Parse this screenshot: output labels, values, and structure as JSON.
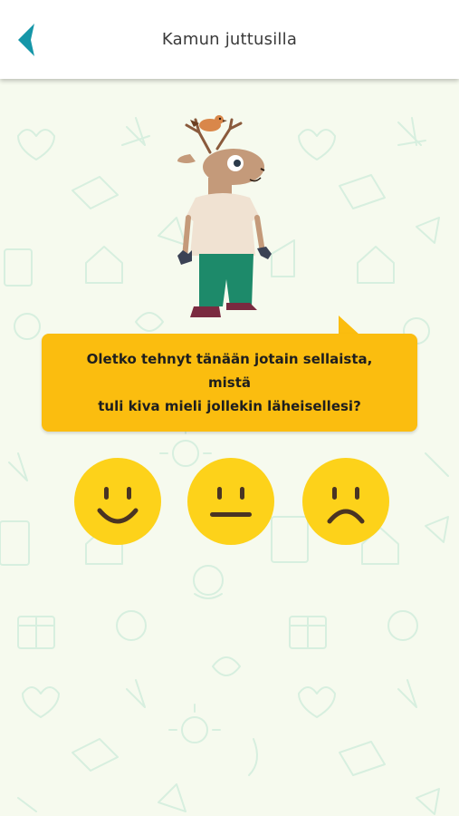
{
  "header": {
    "title": "Kamun juttusilla",
    "back_icon": "chevron-left-icon",
    "accent_color": "#1596a8"
  },
  "bubble": {
    "text": "Oletko tehnyt tänään jotain sellaista, mistä\ntuli kiva mieli jollekin läheisellesi?",
    "color": "#fbbd0f"
  },
  "answers": [
    {
      "icon": "happy-face-icon",
      "mood": "happy"
    },
    {
      "icon": "neutral-face-icon",
      "mood": "neutral"
    },
    {
      "icon": "sad-face-icon",
      "mood": "sad"
    }
  ],
  "colors": {
    "background": "#f6faee",
    "pattern": "#d6eedd",
    "face_fill": "#fdd21a",
    "face_features": "#4a3423"
  }
}
